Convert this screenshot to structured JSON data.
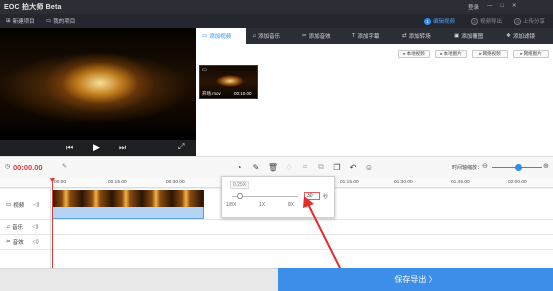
{
  "app": {
    "title": "EOC 拍大师 Beta"
  },
  "topbar": {
    "login": "登录",
    "tools": [
      "—",
      "□",
      "✕"
    ]
  },
  "toolbar": {
    "new_project": "新建项目",
    "my_projects": "我的项目",
    "steps": [
      {
        "num": "1",
        "label": "编辑视频",
        "active": true
      },
      {
        "num": "2",
        "label": "视频导出",
        "active": false
      },
      {
        "num": "3",
        "label": "上传分享",
        "active": false
      }
    ]
  },
  "preview": {
    "timecode": "00:00:00/00:00:00"
  },
  "tabs": [
    {
      "label": "添加视频",
      "icon": "video-icon",
      "active": true
    },
    {
      "label": "添加音乐",
      "icon": "music-icon",
      "active": false
    },
    {
      "label": "添加音效",
      "icon": "sound-effect-icon",
      "active": false
    },
    {
      "label": "添加字幕",
      "icon": "subtitle-icon",
      "active": false
    },
    {
      "label": "添加转场",
      "icon": "transition-icon",
      "active": false
    },
    {
      "label": "添加覆图",
      "icon": "overlay-icon",
      "active": false
    },
    {
      "label": "添加滤镜",
      "icon": "filter-icon",
      "active": false
    }
  ],
  "media_buttons": [
    "本地视频",
    "本地图片",
    "网络视频",
    "网络图片"
  ],
  "media": {
    "filename": "开场.mov",
    "duration": "00:10.00"
  },
  "timeline": {
    "current_time": "00:00.00",
    "zoom_label": "时间轴缩放：",
    "ruler": [
      "00:00",
      "00:15.00",
      "00:30.00",
      "01:15.00",
      "01:30.00",
      "01:45.00",
      "02:00.00"
    ],
    "tracks": [
      {
        "label": "视频",
        "icon": "video-track-icon"
      },
      {
        "label": "音乐",
        "icon": "music-track-icon"
      },
      {
        "label": "音效",
        "icon": "sfx-track-icon"
      }
    ]
  },
  "speed_popup": {
    "current": "0.25X",
    "value": "30",
    "unit": "秒",
    "labels": [
      "1/8X",
      "1X",
      "8X"
    ]
  },
  "footer": {
    "export_label": "保存导出 〉"
  },
  "colors": {
    "accent": "#2f8cf0",
    "export": "#3c8ee8",
    "timecode": "#e03b3b",
    "titlebar": "#2b2e35"
  }
}
